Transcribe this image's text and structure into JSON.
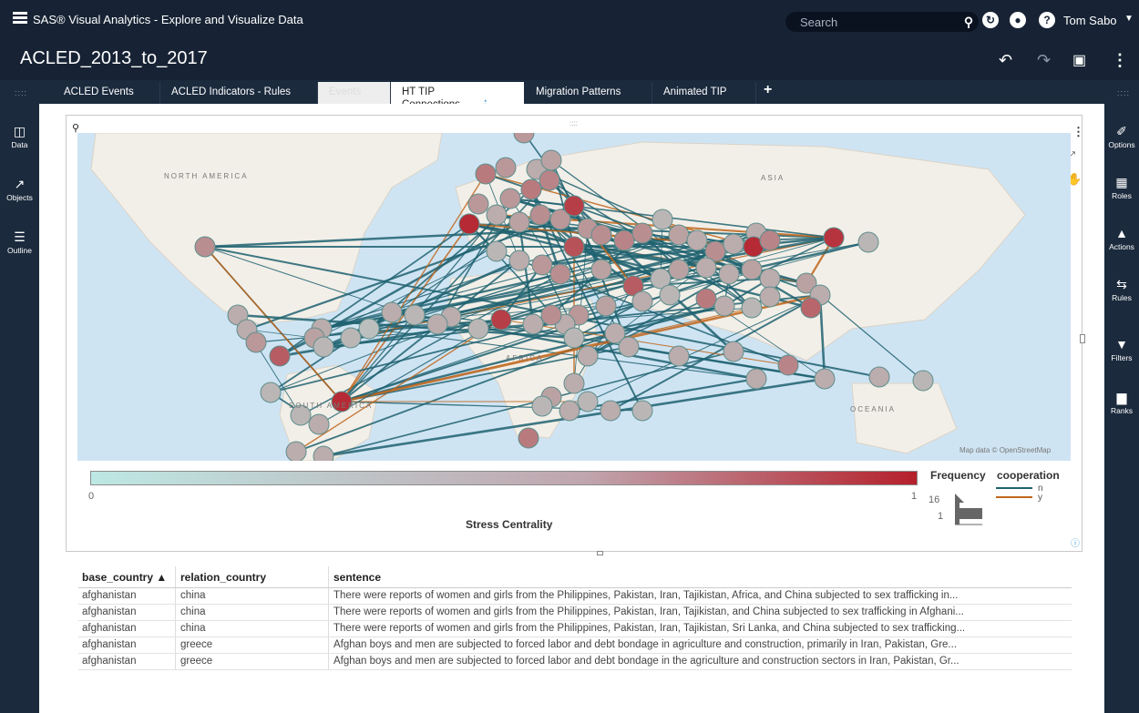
{
  "app": {
    "title": "SAS® Visual Analytics - Explore and Visualize Data"
  },
  "search": {
    "placeholder": "Search"
  },
  "user": {
    "name": "Tom Sabo"
  },
  "report": {
    "title": "ACLED_2013_to_2017"
  },
  "tabs": [
    {
      "label": "ACLED Events"
    },
    {
      "label": "ACLED Indicators - Rules"
    },
    {
      "label": "Events"
    },
    {
      "label": "HT TIP Connections",
      "active": true
    },
    {
      "label": "Migration Patterns"
    },
    {
      "label": "Animated TIP"
    }
  ],
  "left_rail": [
    {
      "label": "Data",
      "icon": "database-icon"
    },
    {
      "label": "Objects",
      "icon": "line-chart-icon"
    },
    {
      "label": "Outline",
      "icon": "outline-icon"
    }
  ],
  "right_rail": [
    {
      "label": "Options",
      "icon": "brush-icon"
    },
    {
      "label": "Roles",
      "icon": "roles-icon"
    },
    {
      "label": "Actions",
      "icon": "actions-icon"
    },
    {
      "label": "Rules",
      "icon": "rules-icon"
    },
    {
      "label": "Filters",
      "icon": "filter-icon"
    },
    {
      "label": "Ranks",
      "icon": "ranks-icon"
    }
  ],
  "map": {
    "labels": {
      "north_america": "NORTH\nAMERICA",
      "asia": "ASIA",
      "africa": "AFRICA",
      "south_america": "SOUTH\nAMERICA",
      "oceania": "OCEANIA"
    },
    "attribution": "Map data © OpenStreetMap"
  },
  "legend": {
    "color_title": "Stress Centrality",
    "color_min": "0",
    "color_max": "1",
    "frequency_title": "Frequency",
    "frequency_max": "16",
    "frequency_min": "1",
    "cooperation_title": "cooperation",
    "cooperation_n": "n",
    "cooperation_y": "y",
    "colors": {
      "low": "#bde8e4",
      "high": "#b5202b",
      "n": "#1f6270",
      "y": "#c0651b"
    }
  },
  "table": {
    "headers": {
      "base_country": "base_country ▲",
      "relation_country": "relation_country",
      "sentence": "sentence"
    },
    "rows": [
      {
        "base_country": "afghanistan",
        "relation_country": "china",
        "sentence": "There were reports of women and girls from the Philippines, Pakistan, Iran, Tajikistan, Africa, and China subjected to sex trafficking in..."
      },
      {
        "base_country": "afghanistan",
        "relation_country": "china",
        "sentence": "There were reports of women and girls from the Philippines, Pakistan, Iran, Tajikistan, and China subjected to sex trafficking in Afghani..."
      },
      {
        "base_country": "afghanistan",
        "relation_country": "china",
        "sentence": "There were reports of women and girls from the Philippines, Pakistan, Iran, Tajikistan, Sri Lanka, and China subjected to sex trafficking..."
      },
      {
        "base_country": "afghanistan",
        "relation_country": "greece",
        "sentence": "Afghan boys and men are subjected to forced labor and debt bondage in agriculture and construction, primarily in Iran, Pakistan, Gre..."
      },
      {
        "base_country": "afghanistan",
        "relation_country": "greece",
        "sentence": "Afghan boys and men are subjected to forced labor and debt bondage in the agriculture and construction sectors in Iran, Pakistan, Gr..."
      }
    ]
  }
}
